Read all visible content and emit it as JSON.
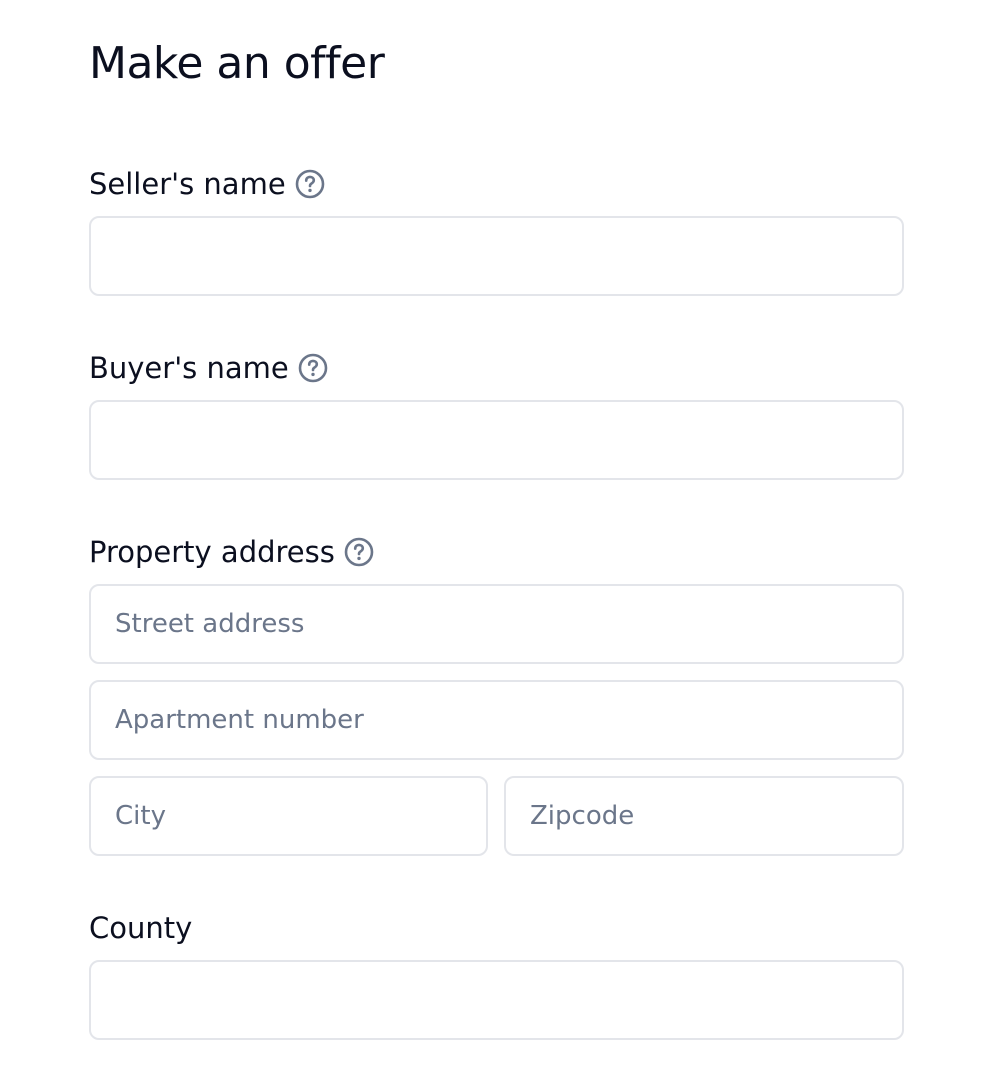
{
  "form": {
    "title": "Make an offer",
    "seller": {
      "label": "Seller's name",
      "value": "",
      "help_icon": "question-circle-icon"
    },
    "buyer": {
      "label": "Buyer's name",
      "value": "",
      "help_icon": "question-circle-icon"
    },
    "property": {
      "label": "Property address",
      "help_icon": "question-circle-icon",
      "street_placeholder": "Street address",
      "apartment_placeholder": "Apartment number",
      "city_placeholder": "City",
      "zipcode_placeholder": "Zipcode"
    },
    "county": {
      "label": "County",
      "value": ""
    }
  },
  "colors": {
    "text": "#0b0f1f",
    "placeholder": "#6b768a",
    "border": "#e3e5ea",
    "icon": "#6b768a",
    "background": "#ffffff"
  }
}
